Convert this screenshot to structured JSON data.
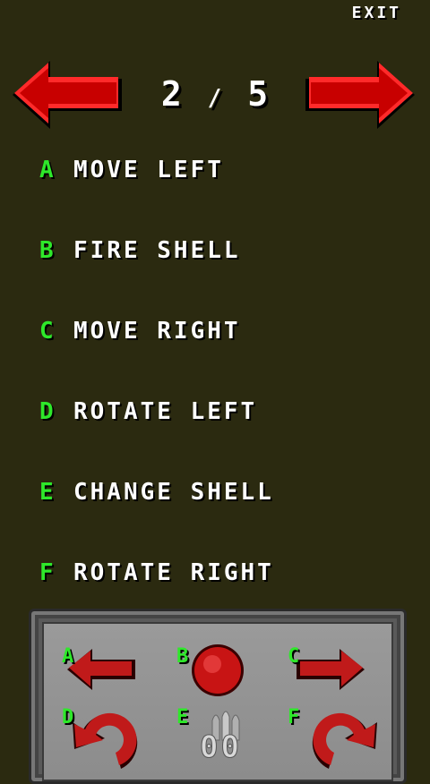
{
  "header": {
    "exit_label": "EXIT"
  },
  "pager": {
    "current": "2",
    "separator": "/",
    "total": "5"
  },
  "mappings": [
    {
      "key": "A",
      "action": "MOVE LEFT"
    },
    {
      "key": "B",
      "action": "FIRE SHELL"
    },
    {
      "key": "C",
      "action": "MOVE RIGHT"
    },
    {
      "key": "D",
      "action": "ROTATE LEFT"
    },
    {
      "key": "E",
      "action": "CHANGE SHELL"
    },
    {
      "key": "F",
      "action": "ROTATE RIGHT"
    }
  ],
  "controls": {
    "labels": [
      "A",
      "B",
      "C",
      "D",
      "E",
      "F"
    ],
    "shell_counter": "00"
  },
  "colors": {
    "background": "#2b2a10",
    "key_green": "#2ee82a",
    "arrow_red": "#e01010",
    "panel_gray": "#8c8c8c"
  },
  "icons": {
    "prev": "big-left-arrow-icon",
    "next": "big-right-arrow-icon",
    "a": "left-arrow-icon",
    "b": "fire-button-icon",
    "c": "right-arrow-icon",
    "d": "rotate-left-icon",
    "e": "shell-icon",
    "f": "rotate-right-icon"
  }
}
